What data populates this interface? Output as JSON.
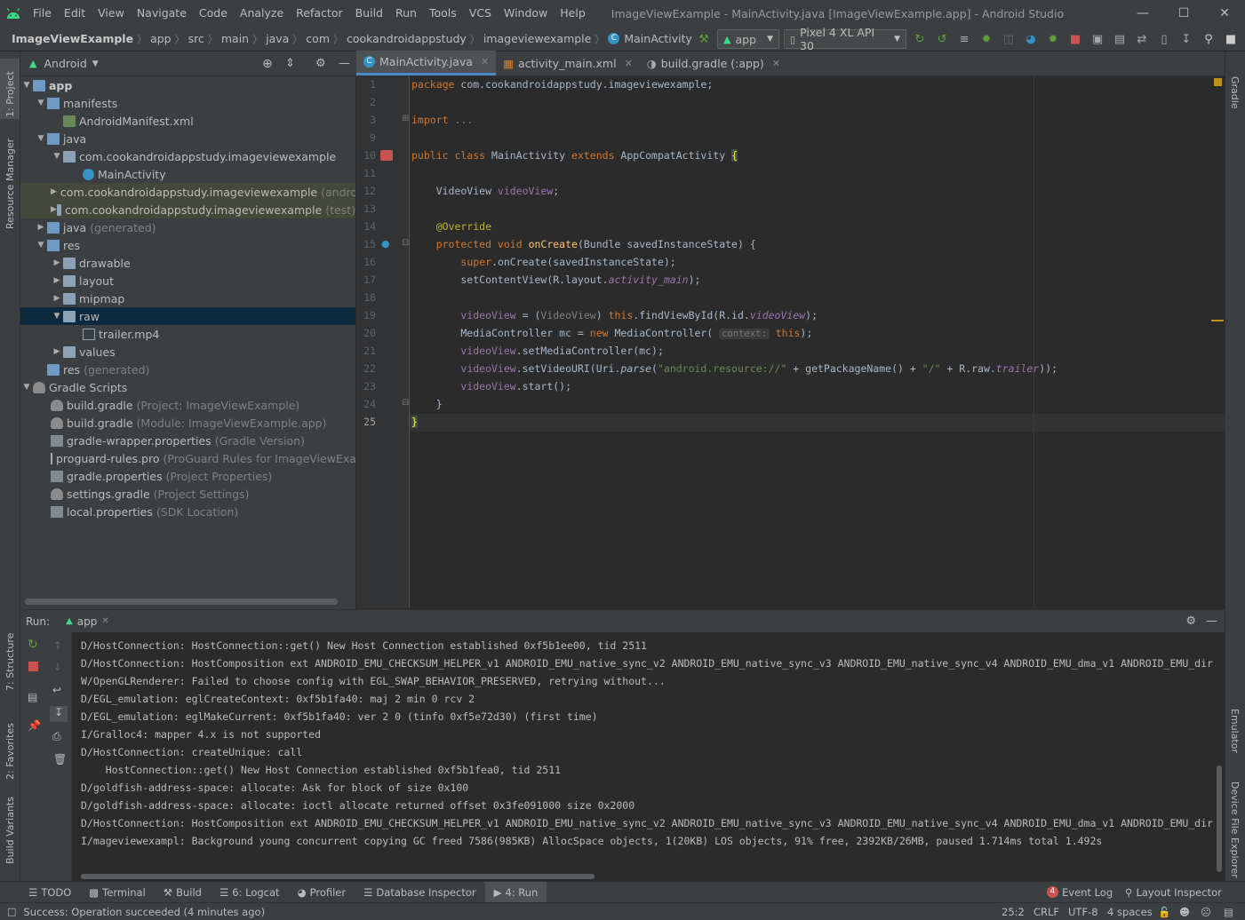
{
  "menubar": {
    "items": [
      "File",
      "Edit",
      "View",
      "Navigate",
      "Code",
      "Analyze",
      "Refactor",
      "Build",
      "Run",
      "Tools",
      "VCS",
      "Window",
      "Help"
    ],
    "title": "ImageViewExample - MainActivity.java [ImageViewExample.app] - Android Studio"
  },
  "navbar": {
    "breadcrumb": [
      "ImageViewExample",
      "app",
      "src",
      "main",
      "java",
      "com",
      "cookandroidappstudy",
      "imageviewexample",
      "MainActivity"
    ],
    "run_config": "app",
    "device": "Pixel 4 XL API 30"
  },
  "left_stripe": {
    "project": "1: Project",
    "resource_manager": "Resource Manager",
    "structure": "7: Structure",
    "favorites": "2: Favorites",
    "build_variants": "Build Variants"
  },
  "right_stripe": {
    "gradle": "Gradle",
    "emulator": "Emulator",
    "device_file_explorer": "Device File Explorer"
  },
  "project": {
    "view_mode": "Android",
    "tree": [
      {
        "label": "app",
        "note": ""
      },
      {
        "label": "manifests",
        "note": ""
      },
      {
        "label": "AndroidManifest.xml",
        "note": ""
      },
      {
        "label": "java",
        "note": ""
      },
      {
        "label": "com.cookandroidappstudy.imageviewexample",
        "note": ""
      },
      {
        "label": "MainActivity",
        "note": ""
      },
      {
        "label": "com.cookandroidappstudy.imageviewexample",
        "note": "(androidTe"
      },
      {
        "label": "com.cookandroidappstudy.imageviewexample",
        "note": "(test)"
      },
      {
        "label": "java",
        "note": "(generated)"
      },
      {
        "label": "res",
        "note": ""
      },
      {
        "label": "drawable",
        "note": ""
      },
      {
        "label": "layout",
        "note": ""
      },
      {
        "label": "mipmap",
        "note": ""
      },
      {
        "label": "raw",
        "note": ""
      },
      {
        "label": "trailer.mp4",
        "note": ""
      },
      {
        "label": "values",
        "note": ""
      },
      {
        "label": "res",
        "note": "(generated)"
      },
      {
        "label": "Gradle Scripts",
        "note": ""
      },
      {
        "label": "build.gradle",
        "note": "(Project: ImageViewExample)"
      },
      {
        "label": "build.gradle",
        "note": "(Module: ImageViewExample.app)"
      },
      {
        "label": "gradle-wrapper.properties",
        "note": "(Gradle Version)"
      },
      {
        "label": "proguard-rules.pro",
        "note": "(ProGuard Rules for ImageViewExample.a"
      },
      {
        "label": "gradle.properties",
        "note": "(Project Properties)"
      },
      {
        "label": "settings.gradle",
        "note": "(Project Settings)"
      },
      {
        "label": "local.properties",
        "note": "(SDK Location)"
      }
    ]
  },
  "editor": {
    "tabs": [
      "MainActivity.java",
      "activity_main.xml",
      "build.gradle (:app)"
    ],
    "line_numbers": [
      "1",
      "2",
      "3",
      "9",
      "10",
      "11",
      "12",
      "13",
      "14",
      "15",
      "16",
      "17",
      "18",
      "19",
      "20",
      "21",
      "22",
      "23",
      "24",
      "25"
    ],
    "code": {
      "l1_kw": "package",
      "l1_rest": " com.cookandroidappstudy.imageviewexample;",
      "l3_kw": "import",
      "l3_rest": " ...",
      "l10_a": "public class",
      "l10_b": " MainActivity ",
      "l10_c": "extends",
      "l10_d": " AppCompatActivity ",
      "l10_e": "{",
      "l12_a": "    VideoView ",
      "l12_b": "videoView",
      "l12_c": ";",
      "l14_a": "    @Override",
      "l15_a": "    protected void ",
      "l15_b": "onCreate",
      "l15_c": "(Bundle savedInstanceState) {",
      "l16_a": "        ",
      "l16_b": "super",
      "l16_c": ".onCreate(savedInstanceState);",
      "l17_a": "        setContentView(R.layout.",
      "l17_b": "activity_main",
      "l17_c": ");",
      "l19_a": "        ",
      "l19_b": "videoView",
      "l19_c": " = (",
      "l19_d": "VideoView",
      "l19_e": ") ",
      "l19_f": "this",
      "l19_g": ".findViewById(R.id.",
      "l19_h": "videoView",
      "l19_i": ");",
      "l20_a": "        MediaController mc = ",
      "l20_b": "new",
      "l20_c": " MediaController( ",
      "l20_hint": "context:",
      "l20_d": " ",
      "l20_e": "this",
      "l20_f": ");",
      "l21_a": "        ",
      "l21_b": "videoView",
      "l21_c": ".setMediaController(mc);",
      "l22_a": "        ",
      "l22_b": "videoView",
      "l22_c": ".setVideoURI(Uri.",
      "l22_d": "parse",
      "l22_e": "(",
      "l22_f": "\"android.resource://\"",
      "l22_g": " + getPackageName() + ",
      "l22_h": "\"/\"",
      "l22_i": " + R.raw.",
      "l22_j": "trailer",
      "l22_k": "));",
      "l23_a": "        ",
      "l23_b": "videoView",
      "l23_c": ".start();",
      "l24_a": "    }",
      "l25_a": "}"
    }
  },
  "run": {
    "label": "Run:",
    "tab": "app",
    "lines": [
      "D/HostConnection: HostConnection::get() New Host Connection established 0xf5b1ee00, tid 2511",
      "D/HostConnection: HostComposition ext ANDROID_EMU_CHECKSUM_HELPER_v1 ANDROID_EMU_native_sync_v2 ANDROID_EMU_native_sync_v3 ANDROID_EMU_native_sync_v4 ANDROID_EMU_dma_v1 ANDROID_EMU_dir",
      "W/OpenGLRenderer: Failed to choose config with EGL_SWAP_BEHAVIOR_PRESERVED, retrying without...",
      "D/EGL_emulation: eglCreateContext: 0xf5b1fa40: maj 2 min 0 rcv 2",
      "D/EGL_emulation: eglMakeCurrent: 0xf5b1fa40: ver 2 0 (tinfo 0xf5e72d30) (first time)",
      "I/Gralloc4: mapper 4.x is not supported",
      "D/HostConnection: createUnique: call",
      "    HostConnection::get() New Host Connection established 0xf5b1fea0, tid 2511",
      "D/goldfish-address-space: allocate: Ask for block of size 0x100",
      "D/goldfish-address-space: allocate: ioctl allocate returned offset 0x3fe091000 size 0x2000",
      "D/HostConnection: HostComposition ext ANDROID_EMU_CHECKSUM_HELPER_v1 ANDROID_EMU_native_sync_v2 ANDROID_EMU_native_sync_v3 ANDROID_EMU_native_sync_v4 ANDROID_EMU_dma_v1 ANDROID_EMU_dir",
      "I/mageviewexampl: Background young concurrent copying GC freed 7586(985KB) AllocSpace objects, 1(20KB) LOS objects, 91% free, 2392KB/26MB, paused 1.714ms total 1.492s"
    ]
  },
  "bottom_tools": {
    "todo": "TODO",
    "terminal": "Terminal",
    "build": "Build",
    "logcat": "6: Logcat",
    "profiler": "Profiler",
    "db": "Database Inspector",
    "run": "4: Run",
    "event_log": "Event Log",
    "event_count": "4",
    "layout_inspector": "Layout Inspector"
  },
  "status": {
    "message": "Success: Operation succeeded (4 minutes ago)",
    "position": "25:2",
    "line_sep": "CRLF",
    "encoding": "UTF-8",
    "indent": "4 spaces"
  }
}
